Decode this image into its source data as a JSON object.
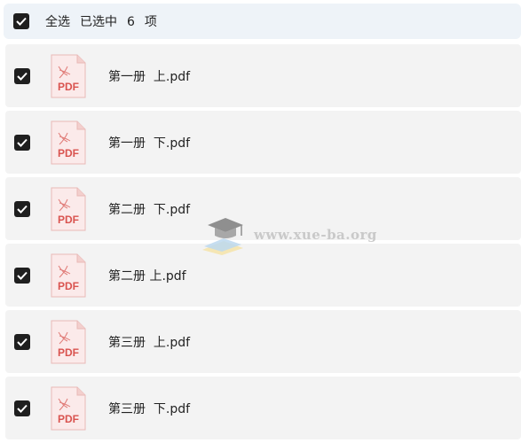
{
  "select_bar": {
    "label_parts": [
      "全选",
      "已选中",
      "6",
      "项"
    ],
    "checked": true
  },
  "files": [
    {
      "name": "第一册  上.pdf",
      "icon": "pdf-file-icon",
      "icon_text": "PDF",
      "checked": true
    },
    {
      "name": "第一册  下.pdf",
      "icon": "pdf-file-icon",
      "icon_text": "PDF",
      "checked": true
    },
    {
      "name": "第二册  下.pdf",
      "icon": "pdf-file-icon",
      "icon_text": "PDF",
      "checked": true
    },
    {
      "name": "第二册 上.pdf",
      "icon": "pdf-file-icon",
      "icon_text": "PDF",
      "checked": true
    },
    {
      "name": "第三册  上.pdf",
      "icon": "pdf-file-icon",
      "icon_text": "PDF",
      "checked": true
    },
    {
      "name": "第三册  下.pdf",
      "icon": "pdf-file-icon",
      "icon_text": "PDF",
      "checked": true
    }
  ],
  "watermark": {
    "text": "www.xue-ba.org",
    "icon": "graduation-cap-icon"
  },
  "colors": {
    "checkbox": "#1f1f1f",
    "pdf_red": "#d9534f",
    "row_bg": "#f3f3f3",
    "select_bar_bg": "#eef3f8"
  }
}
